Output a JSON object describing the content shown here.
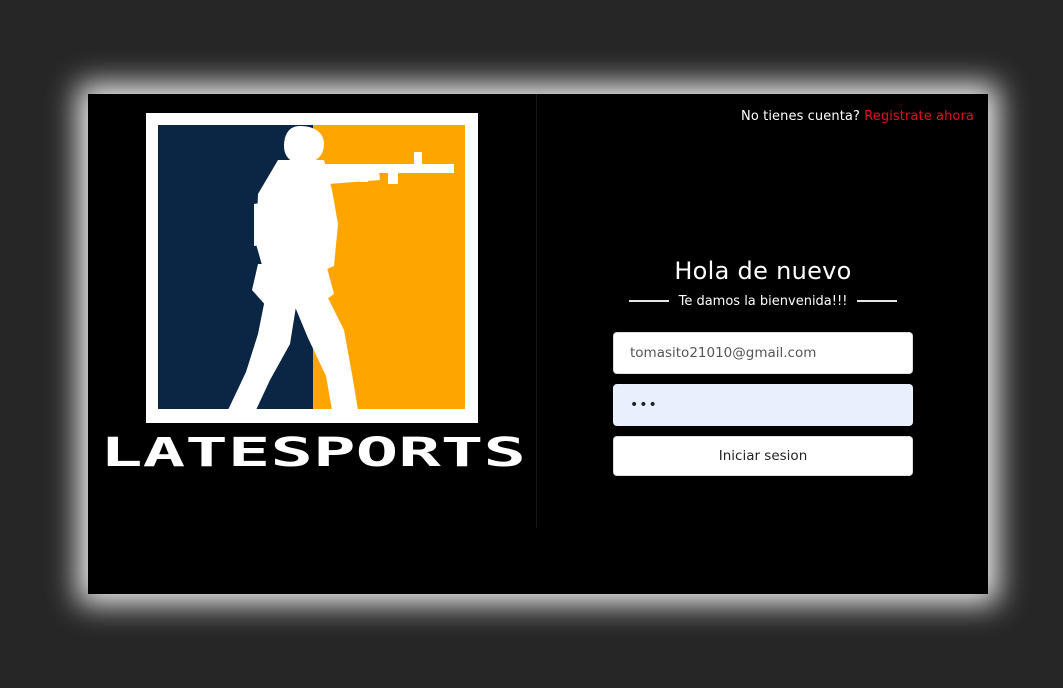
{
  "brand": {
    "name": "LATESPORTS",
    "colors": {
      "navy": "#0b2545",
      "orange": "#ffa500",
      "frame": "#ffffff"
    }
  },
  "topbar": {
    "prompt": "No tienes cuenta?",
    "register_link": "Registrate ahora",
    "link_color": "#e3121b"
  },
  "login": {
    "title": "Hola de nuevo",
    "subtitle": "Te damos la bienvenida!!!",
    "email_value": "tomasito21010@gmail.com",
    "password_value": "•••",
    "submit_label": "Iniciar sesion"
  }
}
